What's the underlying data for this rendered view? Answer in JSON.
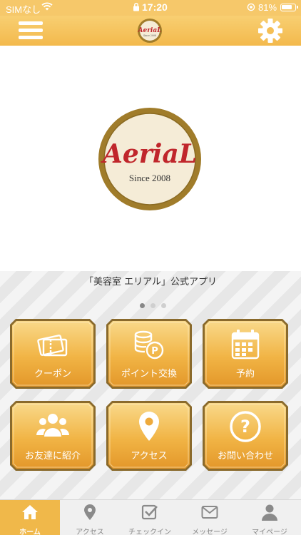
{
  "status_bar": {
    "carrier": "SIMなし",
    "time": "17:20",
    "battery": "81%",
    "battery_level": 0.81
  },
  "header": {
    "logo_text": "AeriaL",
    "logo_sub": "Since 2008"
  },
  "hero": {
    "logo_text": "AeriaL",
    "logo_sub": "Since 2008"
  },
  "caption": "「美容室 エリアル」公式アプリ",
  "carousel": {
    "count": 3,
    "active": 0
  },
  "tiles": [
    {
      "label": "クーポン",
      "icon": "ticket-icon"
    },
    {
      "label": "ポイント交換",
      "icon": "coins-icon"
    },
    {
      "label": "予約",
      "icon": "calendar-icon"
    },
    {
      "label": "お友達に紹介",
      "icon": "friends-icon"
    },
    {
      "label": "アクセス",
      "icon": "location-pin-icon"
    },
    {
      "label": "お問い合わせ",
      "icon": "question-icon"
    }
  ],
  "tabs": [
    {
      "label": "ホーム",
      "icon": "home-icon",
      "active": true
    },
    {
      "label": "アクセス",
      "icon": "location-pin-icon"
    },
    {
      "label": "チェックイン",
      "icon": "checkin-icon"
    },
    {
      "label": "メッセージ",
      "icon": "mail-icon"
    },
    {
      "label": "マイページ",
      "icon": "person-icon"
    }
  ],
  "colors": {
    "accent": "#f3b94c",
    "logo_gold": "#a07c2a",
    "logo_red": "#c0262b",
    "logo_cream": "#f5ecd7"
  }
}
